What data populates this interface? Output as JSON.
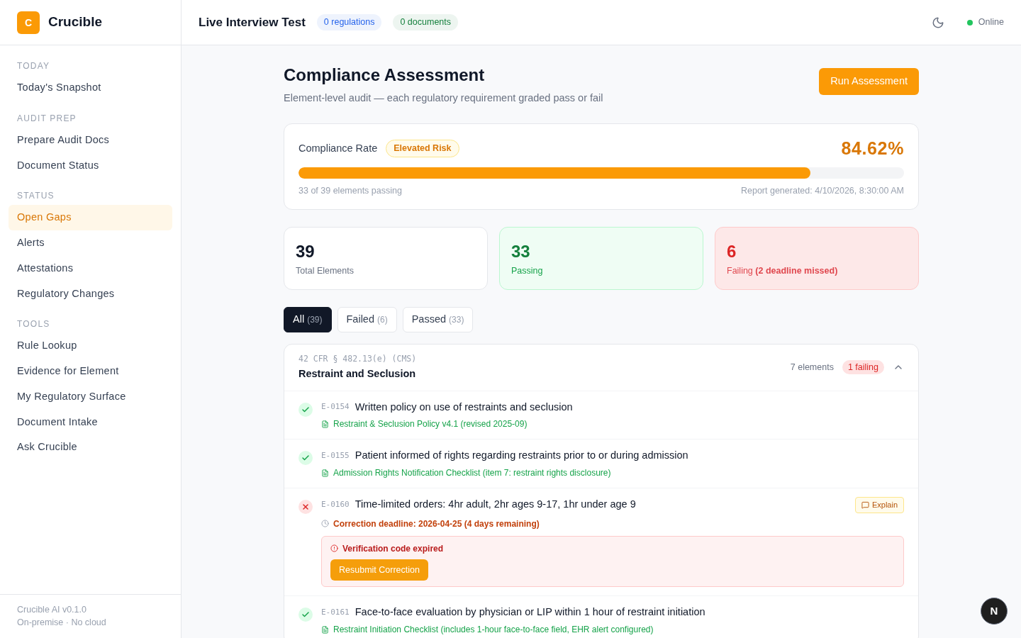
{
  "brand": {
    "logo": "C",
    "name": "Crucible"
  },
  "sidebar": {
    "sections": [
      {
        "heading": "TODAY",
        "items": [
          {
            "label": "Today's Snapshot",
            "selected": false
          }
        ]
      },
      {
        "heading": "AUDIT PREP",
        "items": [
          {
            "label": "Prepare Audit Docs",
            "selected": false
          },
          {
            "label": "Document Status",
            "selected": false
          }
        ]
      },
      {
        "heading": "STATUS",
        "items": [
          {
            "label": "Open Gaps",
            "selected": true
          },
          {
            "label": "Alerts",
            "selected": false
          },
          {
            "label": "Attestations",
            "selected": false
          },
          {
            "label": "Regulatory Changes",
            "selected": false
          }
        ]
      },
      {
        "heading": "TOOLS",
        "items": [
          {
            "label": "Rule Lookup",
            "selected": false
          },
          {
            "label": "Evidence for Element",
            "selected": false
          },
          {
            "label": "My Regulatory Surface",
            "selected": false
          },
          {
            "label": "Document Intake",
            "selected": false
          },
          {
            "label": "Ask Crucible",
            "selected": false
          }
        ]
      }
    ],
    "footer": [
      "Crucible AI v0.1.0",
      "On-premise · No cloud"
    ]
  },
  "topbar": {
    "title": "Live Interview Test",
    "badges": [
      {
        "label": "0 regulations",
        "color": "#2563eb"
      },
      {
        "label": "0 documents",
        "color": "#15803d"
      }
    ],
    "status": {
      "label": "Online",
      "color": "#22c55e"
    }
  },
  "page": {
    "title": "Compliance Assessment",
    "subtitle": "Element-level audit — each regulatory requirement graded pass or fail",
    "action": "Run Assessment"
  },
  "rate": {
    "label": "Compliance Rate",
    "risk": "Elevated Risk",
    "value": "84.62%",
    "level": 0.846,
    "passing": "33 of 39 elements passing",
    "generated": "Report generated: 4/10/2026, 8:30:00 AM"
  },
  "stats": [
    {
      "kind": "neutral",
      "value": "39",
      "label": "Total Elements"
    },
    {
      "kind": "pass",
      "value": "33",
      "label": "Passing"
    },
    {
      "kind": "fail",
      "value": "6",
      "label": "Failing **(2 deadline missed)**"
    }
  ],
  "filters": [
    {
      "label": "All",
      "count": "(39)",
      "selected": true
    },
    {
      "label": "Failed",
      "count": "(6)",
      "selected": false
    },
    {
      "label": "Passed",
      "count": "(33)",
      "selected": false
    }
  ],
  "group": {
    "citation": "42 CFR § 482.13(e) (CMS)",
    "title": "Restraint and Seclusion",
    "count": "7 elements",
    "failing": "1 failing",
    "expanded": true,
    "elements": [
      {
        "kind": "pass",
        "id": "E-0154",
        "text": "Written policy on use of restraints and seclusion",
        "evidence": "Restraint & Seclusion Policy v4.1 (revised 2025-09)"
      },
      {
        "kind": "pass",
        "id": "E-0155",
        "text": "Patient informed of rights regarding restraints prior to or during admission",
        "evidence": "Admission Rights Notification Checklist (item 7: restraint rights disclosure)"
      },
      {
        "kind": "fail",
        "id": "E-0160",
        "text": "Time-limited orders: 4hr adult, 2hr ages 9-17, 1hr under age 9",
        "explain": "Explain",
        "deadline": "Correction deadline: 2026-04-25 (4 days remaining)",
        "error": "Verification code expired",
        "action": "Resubmit Correction"
      },
      {
        "kind": "pass",
        "id": "E-0161",
        "text": "Face-to-face evaluation by physician or LIP within 1 hour of restraint initiation",
        "evidence": "Restraint Initiation Checklist (includes 1-hour face-to-face field, EHR alert configured)"
      }
    ]
  },
  "dev_badge": "N"
}
